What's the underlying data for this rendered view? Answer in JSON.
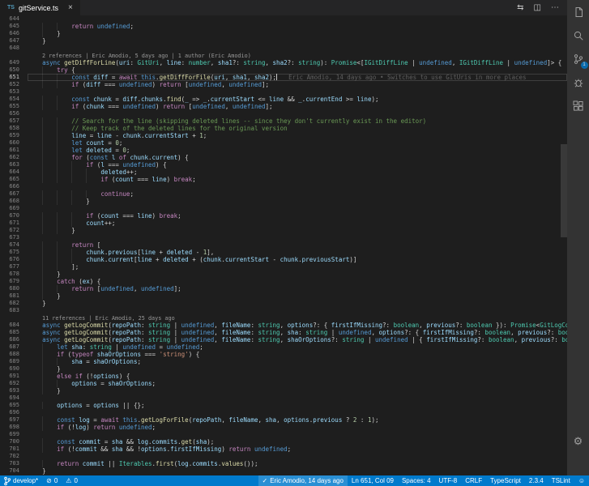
{
  "theme": {
    "editor_bg": "#1e1e1e",
    "tab_bar_bg": "#252526",
    "activity_bar_bg": "#333333",
    "status_bar_bg": "#007acc",
    "accent": "#007acc"
  },
  "syntax": {
    "default": "#d4d4d4",
    "keyword_control": "#c586c0",
    "keyword": "#569cd6",
    "type": "#4ec9b0",
    "function": "#dcdcaa",
    "variable": "#9cdcfe",
    "string": "#ce9178",
    "number": "#b5cea8",
    "comment": "#6a9955",
    "codelens": "#999999",
    "blame": "#5f5f5f",
    "line_number": "#858585",
    "line_number_active": "#c6c6c6"
  },
  "glyphs": {
    "gear-icon": "⚙",
    "error-icon": "⊘",
    "warning-icon": "⚠",
    "check-icon": "✓",
    "smiley-icon": "☺",
    "open-changes-icon": "⇆",
    "split-editor-icon": "◫",
    "more-actions-icon": "⋯"
  },
  "tab": {
    "filetype_icon": "TS",
    "filename": "gitService.ts",
    "close_glyph": "×"
  },
  "editor_actions": [
    {
      "name": "open-changes-icon"
    },
    {
      "name": "split-editor-icon"
    },
    {
      "name": "more-actions-icon"
    }
  ],
  "activity_bar": {
    "scm_badge": "1"
  },
  "editor": {
    "lines": [
      {
        "number": 644,
        "text": ""
      },
      {
        "number": 645,
        "text": "            return undefined;"
      },
      {
        "number": 646,
        "text": "        }"
      },
      {
        "number": 647,
        "text": "    }"
      },
      {
        "number": 648,
        "text": ""
      },
      {
        "lens": "2 references | Eric Amodio, 5 days ago | 1 author (Eric Amodio)"
      },
      {
        "number": 649,
        "text": "    async getDiffForLine(uri: GitUri, line: number, sha1?: string, sha2?: string): Promise<[IGitDiffLine | undefined, IGitDiffLine | undefined]> {"
      },
      {
        "number": 650,
        "text": "        try {"
      },
      {
        "number": 651,
        "text": "            const diff = await this.getDiffForFile(uri, sha1, sha2);",
        "current": true,
        "cursor": true,
        "blame": "Eric Amodio, 14 days ago • Switches to use GitUris in more places"
      },
      {
        "number": 652,
        "text": "            if (diff === undefined) return [undefined, undefined];"
      },
      {
        "number": 653,
        "text": ""
      },
      {
        "number": 654,
        "text": "            const chunk = diff.chunks.find(_ => _.currentStart <= line && _.currentEnd >= line);"
      },
      {
        "number": 655,
        "text": "            if (chunk === undefined) return [undefined, undefined];"
      },
      {
        "number": 656,
        "text": ""
      },
      {
        "number": 657,
        "text": "            // Search for the line (skipping deleted lines -- since they don't currently exist in the editor)"
      },
      {
        "number": 658,
        "text": "            // Keep track of the deleted lines for the original version"
      },
      {
        "number": 659,
        "text": "            line = line - chunk.currentStart + 1;"
      },
      {
        "number": 660,
        "text": "            let count = 0;"
      },
      {
        "number": 661,
        "text": "            let deleted = 0;"
      },
      {
        "number": 662,
        "text": "            for (const l of chunk.current) {"
      },
      {
        "number": 663,
        "text": "                if (l === undefined) {"
      },
      {
        "number": 664,
        "text": "                    deleted++;"
      },
      {
        "number": 665,
        "text": "                    if (count === line) break;"
      },
      {
        "number": 666,
        "text": ""
      },
      {
        "number": 667,
        "text": "                    continue;"
      },
      {
        "number": 668,
        "text": "                }"
      },
      {
        "number": 669,
        "text": ""
      },
      {
        "number": 670,
        "text": "                if (count === line) break;"
      },
      {
        "number": 671,
        "text": "                count++;"
      },
      {
        "number": 672,
        "text": "            }"
      },
      {
        "number": 673,
        "text": ""
      },
      {
        "number": 674,
        "text": "            return ["
      },
      {
        "number": 675,
        "text": "                chunk.previous[line + deleted - 1],"
      },
      {
        "number": 676,
        "text": "                chunk.current[line + deleted + (chunk.currentStart - chunk.previousStart)]"
      },
      {
        "number": 677,
        "text": "            ];"
      },
      {
        "number": 678,
        "text": "        }"
      },
      {
        "number": 679,
        "text": "        catch (ex) {"
      },
      {
        "number": 680,
        "text": "            return [undefined, undefined];"
      },
      {
        "number": 681,
        "text": "        }"
      },
      {
        "number": 682,
        "text": "    }"
      },
      {
        "number": 683,
        "text": ""
      },
      {
        "lens": "11 references | Eric Amodio, 25 days ago"
      },
      {
        "number": 684,
        "text": "    async getLogCommit(repoPath: string | undefined, fileName: string, options?: { firstIfMissing?: boolean, previous?: boolean }): Promise<GitLogCommit | undefined>;"
      },
      {
        "number": 685,
        "text": "    async getLogCommit(repoPath: string | undefined, fileName: string, sha: string | undefined, options?: { firstIfMissing?: boolean, previous?: boolean }): Promise<GitLogCommit | undefined>;"
      },
      {
        "number": 686,
        "text": "    async getLogCommit(repoPath: string | undefined, fileName: string, shaOrOptions?: string | undefined | { firstIfMissing?: boolean, previous?: boolean }, options?: { firstIfMissing?: boolean, previous?: boolean }): Promise<GitLogCommit | undefined> {"
      },
      {
        "number": 687,
        "text": "        let sha: string | undefined = undefined;"
      },
      {
        "number": 688,
        "text": "        if (typeof shaOrOptions === 'string') {"
      },
      {
        "number": 689,
        "text": "            sha = shaOrOptions;"
      },
      {
        "number": 690,
        "text": "        }"
      },
      {
        "number": 691,
        "text": "        else if (!options) {"
      },
      {
        "number": 692,
        "text": "            options = shaOrOptions;"
      },
      {
        "number": 693,
        "text": "        }"
      },
      {
        "number": 694,
        "text": ""
      },
      {
        "number": 695,
        "text": "        options = options || {};"
      },
      {
        "number": 696,
        "text": ""
      },
      {
        "number": 697,
        "text": "        const log = await this.getLogForFile(repoPath, fileName, sha, options.previous ? 2 : 1);"
      },
      {
        "number": 698,
        "text": "        if (!log) return undefined;"
      },
      {
        "number": 699,
        "text": ""
      },
      {
        "number": 700,
        "text": "        const commit = sha && log.commits.get(sha);"
      },
      {
        "number": 701,
        "text": "        if (!commit && sha && !options.firstIfMissing) return undefined;"
      },
      {
        "number": 702,
        "text": ""
      },
      {
        "number": 703,
        "text": "        return commit || Iterables.first(log.commits.values());"
      },
      {
        "number": 704,
        "text": "    }"
      }
    ]
  },
  "status_bar": {
    "left": [
      {
        "name": "git-branch-status",
        "icon": "git-branch-icon",
        "label": "develop*"
      },
      {
        "name": "errors-status",
        "icon": "error-icon",
        "label": "0"
      },
      {
        "name": "warnings-status",
        "icon": "warning-icon",
        "label": "0"
      }
    ],
    "right": [
      {
        "name": "gitlens-blame-status",
        "icon": "check-icon",
        "label": "Eric Amodio, 14 days ago",
        "highlight": true
      },
      {
        "name": "cursor-position-status",
        "label": "Ln 651, Col 09"
      },
      {
        "name": "indentation-status",
        "label": "Spaces: 4"
      },
      {
        "name": "encoding-status",
        "label": "UTF-8"
      },
      {
        "name": "eol-status",
        "label": "CRLF"
      },
      {
        "name": "language-status",
        "label": "TypeScript"
      },
      {
        "name": "version-status",
        "label": "2.3.4"
      },
      {
        "name": "tslint-status",
        "label": "TSLint"
      },
      {
        "name": "feedback-status",
        "icon": "smiley-icon"
      }
    ]
  }
}
